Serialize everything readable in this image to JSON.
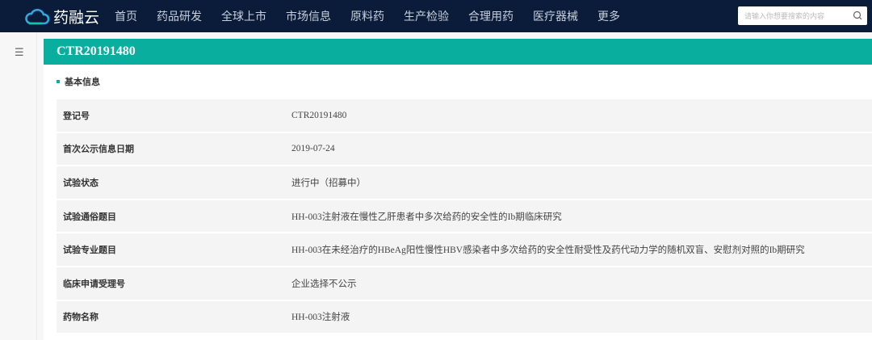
{
  "nav": {
    "logo_text": "药融云",
    "items": [
      "首页",
      "药品研发",
      "全球上市",
      "市场信息",
      "原料药",
      "生产检验",
      "合理用药",
      "医疗器械",
      "更多"
    ],
    "search_placeholder": "请输入你想要搜索的内容",
    "colors": {
      "bg": "#0a1c3a",
      "accent": "#0aae9f"
    }
  },
  "page": {
    "title": "CTR20191480",
    "section": "基本信息"
  },
  "rows": [
    {
      "label": "登记号",
      "value": "CTR20191480"
    },
    {
      "label": "首次公示信息日期",
      "value": "2019-07-24"
    },
    {
      "label": "试验状态",
      "value": "进行中（招募中）"
    },
    {
      "label": "试验通俗题目",
      "value": "HH-003注射液在慢性乙肝患者中多次给药的安全性的Ib期临床研究"
    },
    {
      "label": "试验专业题目",
      "value": "HH-003在未经治疗的HBeAg阳性慢性HBV感染者中多次给药的安全性耐受性及药代动力学的随机双盲、安慰剂对照的Ib期研究"
    },
    {
      "label": "临床申请受理号",
      "value": "企业选择不公示"
    },
    {
      "label": "药物名称",
      "value": "HH-003注射液"
    }
  ]
}
